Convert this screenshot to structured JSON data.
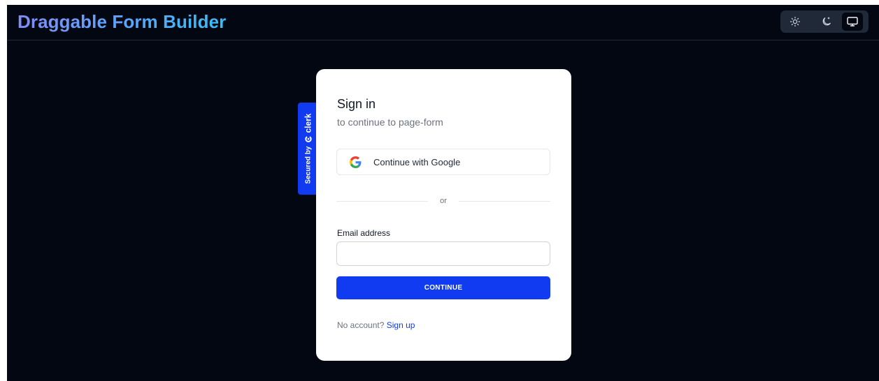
{
  "app": {
    "title": "Draggable Form Builder"
  },
  "theme_switcher": {
    "options": [
      "light",
      "dark",
      "system"
    ],
    "selected": "system"
  },
  "clerk_badge": {
    "secured_by": "Secured by",
    "brand": "clerk"
  },
  "signin": {
    "title": "Sign in",
    "subtitle": "to continue to page-form",
    "google_button": "Continue with Google",
    "divider_text": "or",
    "email_label": "Email address",
    "email_value": "",
    "continue_button": "CONTINUE",
    "footer_prompt": "No account?",
    "signup_link": "Sign up"
  },
  "colors": {
    "background": "#030712",
    "accent": "#103bf0",
    "card": "#ffffff",
    "title_gradient_start": "#818cf8",
    "title_gradient_end": "#38bdf8"
  }
}
